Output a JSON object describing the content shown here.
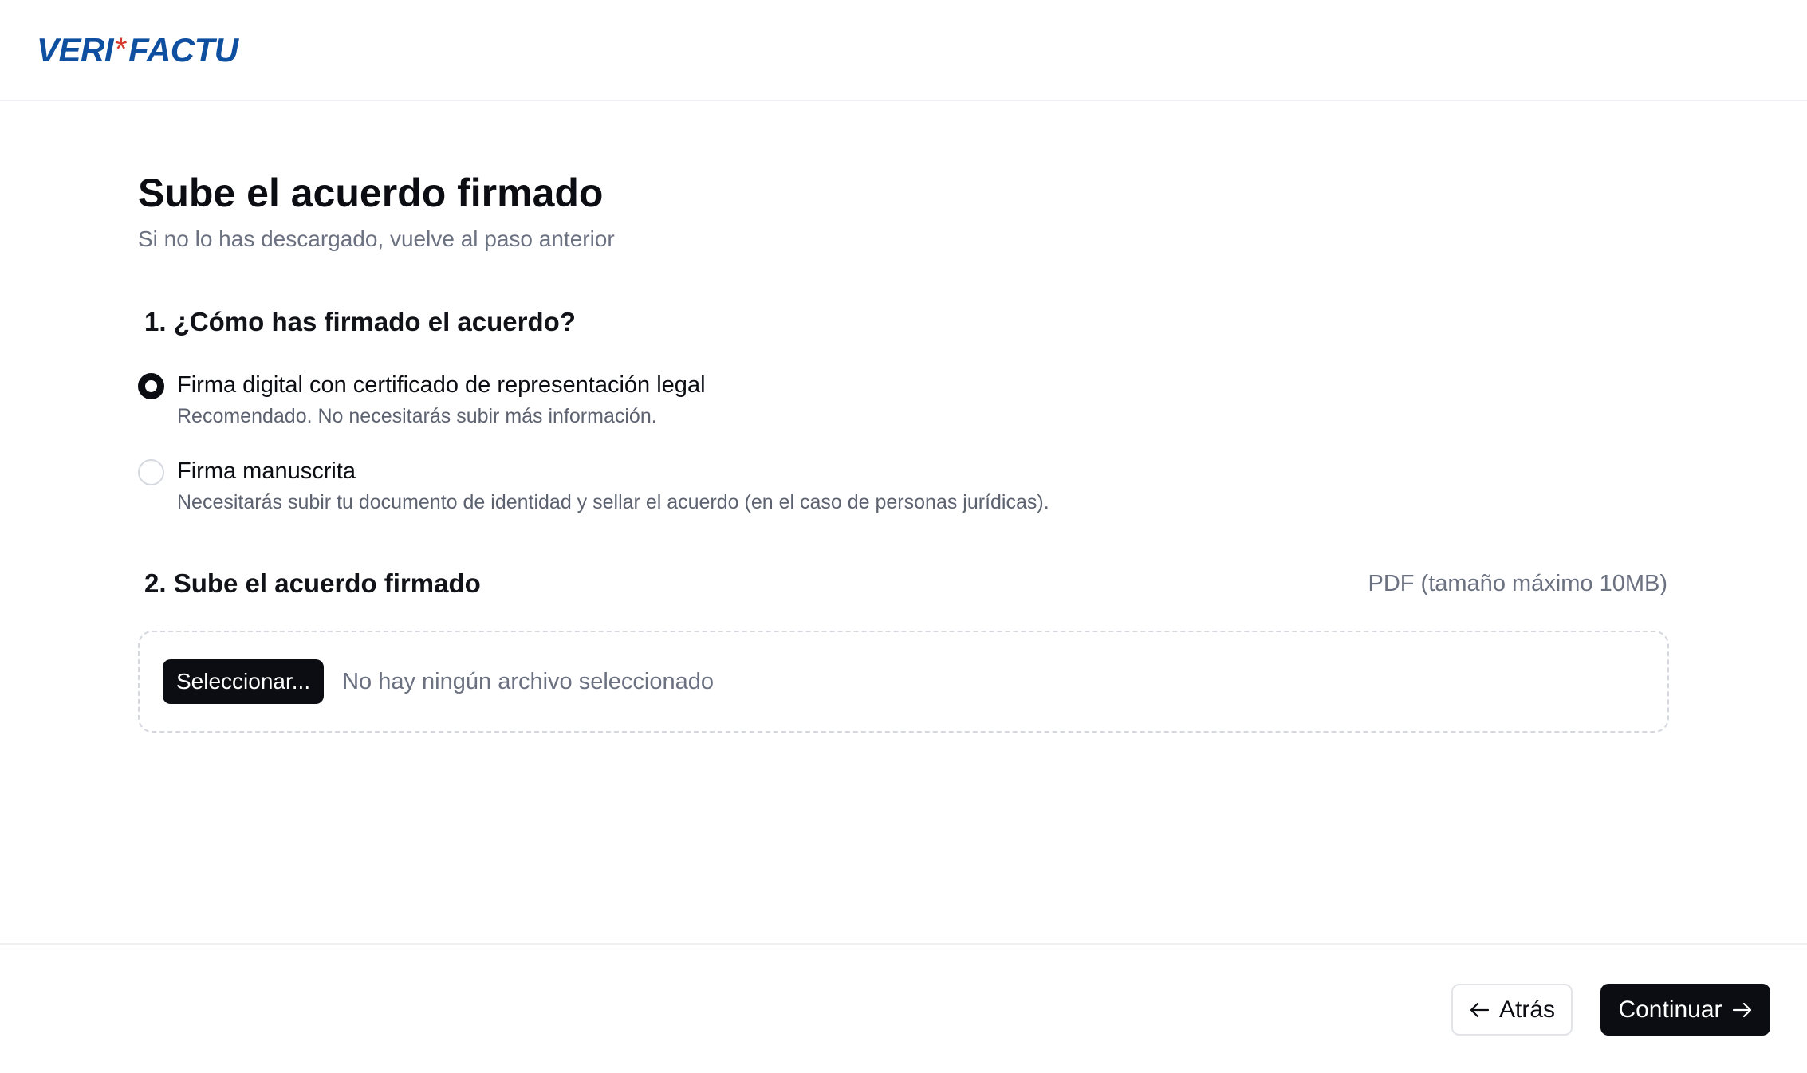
{
  "header": {
    "logo_left": "VERI",
    "logo_star": "*",
    "logo_right": "FACTU",
    "logo_colors": {
      "text": "#0f4fa0",
      "star": "#d63a2f"
    }
  },
  "page": {
    "title": "Sube el acuerdo firmado",
    "subtitle": "Si no lo has descargado, vuelve al paso anterior"
  },
  "step1": {
    "title": "1. ¿Cómo has firmado el acuerdo?",
    "options": [
      {
        "label": "Firma digital con certificado de representación legal",
        "description": "Recomendado. No necesitarás subir más información.",
        "selected": true
      },
      {
        "label": "Firma manuscrita",
        "description": "Necesitarás subir tu documento de identidad y sellar el acuerdo (en el caso de personas jurídicas).",
        "selected": false
      }
    ]
  },
  "step2": {
    "title": "2. Sube el acuerdo firmado",
    "hint": "PDF (tamaño máximo 10MB)",
    "select_label": "Seleccionar...",
    "no_file": "No hay ningún archivo seleccionado"
  },
  "footer": {
    "back_label": "Atrás",
    "back_icon": "arrow-left-icon",
    "next_label": "Continuar",
    "next_icon": "arrow-right-icon"
  }
}
